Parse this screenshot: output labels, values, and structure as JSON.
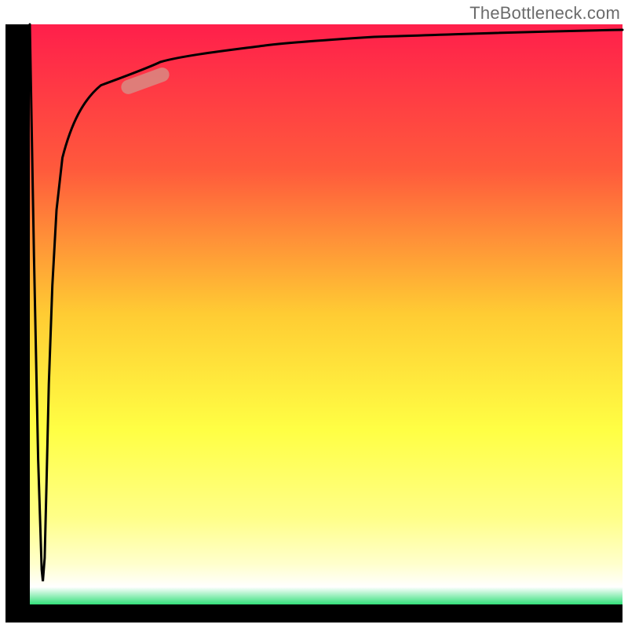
{
  "attribution": "TheBottleneck.com",
  "chart_data": {
    "type": "line",
    "title": "",
    "xlabel": "",
    "ylabel": "",
    "xlim": [
      0,
      100
    ],
    "ylim": [
      0,
      100
    ],
    "grid": false,
    "legend": false,
    "background_gradient": {
      "stops": [
        {
          "offset": 0.0,
          "color": "#ff1f4b"
        },
        {
          "offset": 0.25,
          "color": "#ff5a3c"
        },
        {
          "offset": 0.5,
          "color": "#ffcc33"
        },
        {
          "offset": 0.7,
          "color": "#ffff44"
        },
        {
          "offset": 0.85,
          "color": "#ffff88"
        },
        {
          "offset": 0.93,
          "color": "#ffffcc"
        },
        {
          "offset": 0.97,
          "color": "#ffffff"
        },
        {
          "offset": 1.0,
          "color": "#33e07a"
        }
      ]
    },
    "series": [
      {
        "name": "curve",
        "x": [
          0.0,
          0.7,
          1.4,
          2.0,
          2.2,
          2.5,
          2.8,
          3.2,
          3.8,
          4.5,
          5.5,
          7.0,
          9.0,
          12.0,
          16.0,
          22.0,
          30.0,
          40.0,
          55.0,
          75.0,
          100.0
        ],
        "y": [
          100.0,
          60.0,
          25.0,
          6.0,
          4.0,
          8.0,
          20.0,
          38.0,
          55.0,
          68.0,
          77.0,
          83.0,
          87.0,
          89.5,
          91.0,
          92.2,
          93.2,
          94.0,
          94.8,
          95.6,
          96.4
        ]
      }
    ],
    "highlight": {
      "x_range": [
        16.0,
        24.0
      ],
      "y_range": [
        90.5,
        92.5
      ],
      "style": "pill"
    },
    "notes": "Axes are unlabeled; values are normalized 0–100 estimates read from the image proportions. The curve drops sharply from top-left to near the bottom very close to x≈2, then rises steeply and asymptotically approaches ~96 toward the right edge. A rounded salmon-colored pill highlights a short segment of the rising curve near the upper-left."
  }
}
